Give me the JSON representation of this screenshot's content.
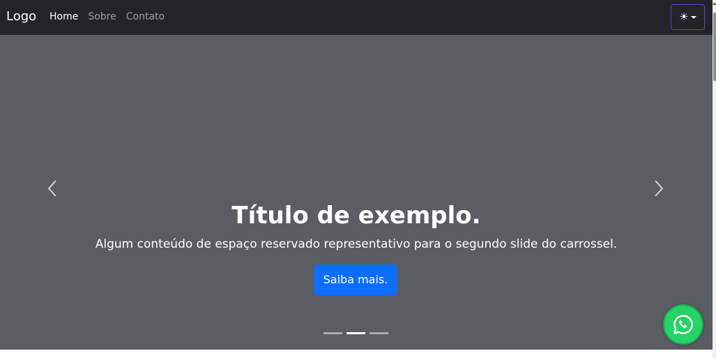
{
  "navbar": {
    "brand": "Logo",
    "links": [
      "Home",
      "Sobre",
      "Contato"
    ],
    "theme_icon": "sun-icon"
  },
  "carousel": {
    "title": "Título de exemplo.",
    "text": "Algum conteúdo de espaço reservado representativo para o segundo slide do carrossel.",
    "button_label": "Saiba mais.",
    "slide_count": 3,
    "active_slide": 2
  },
  "float_button": {
    "icon": "whatsapp-icon"
  },
  "colors": {
    "navbar_bg": "#212529",
    "carousel_bg": "#5a5d61",
    "primary": "#0d6efd",
    "whatsapp": "#25d366",
    "theme_border": "#6f42c1"
  }
}
